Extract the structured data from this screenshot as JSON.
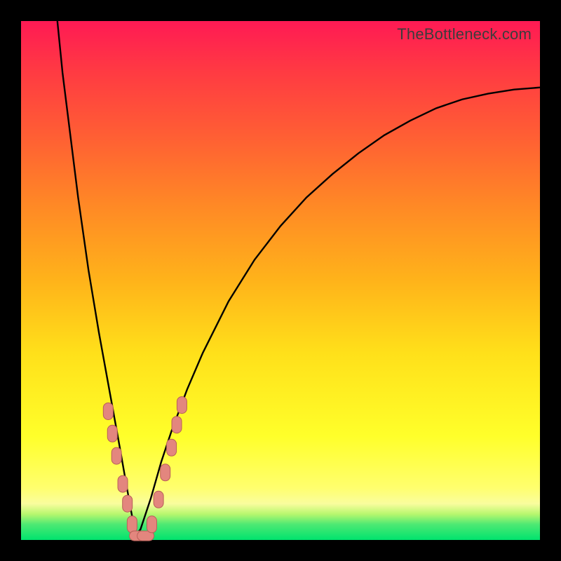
{
  "watermark": "TheBottleneck.com",
  "colors": {
    "curve": "#000000",
    "marker_fill": "#e3867e",
    "marker_stroke": "#b86058",
    "frame": "#000000"
  },
  "chart_data": {
    "type": "line",
    "title": "",
    "xlabel": "",
    "ylabel": "",
    "xlim": [
      0,
      1
    ],
    "ylim": [
      0,
      1
    ],
    "grid": false,
    "legend": false,
    "notes": "V-shaped bottleneck curve with minimum near x≈0.22, y≈0. Left branch reaches y≈1 at x≈0.07; right branch rises toward y≈0.86 at x=1. Pink rounded markers cluster near the trough on both branches.",
    "series": [
      {
        "name": "curve",
        "x": [
          0.07,
          0.08,
          0.095,
          0.11,
          0.13,
          0.15,
          0.17,
          0.19,
          0.205,
          0.215,
          0.22,
          0.23,
          0.25,
          0.27,
          0.29,
          0.32,
          0.35,
          0.4,
          0.45,
          0.5,
          0.55,
          0.6,
          0.65,
          0.7,
          0.75,
          0.8,
          0.85,
          0.9,
          0.95,
          1.0
        ],
        "y": [
          1.0,
          0.9,
          0.78,
          0.66,
          0.52,
          0.4,
          0.29,
          0.18,
          0.095,
          0.04,
          0.01,
          0.02,
          0.08,
          0.15,
          0.21,
          0.29,
          0.36,
          0.46,
          0.54,
          0.605,
          0.66,
          0.705,
          0.745,
          0.78,
          0.808,
          0.832,
          0.849,
          0.86,
          0.868,
          0.872
        ]
      }
    ],
    "markers": {
      "name": "threshold-markers",
      "shape": "rounded-pill",
      "points": [
        {
          "x": 0.168,
          "y": 0.248
        },
        {
          "x": 0.176,
          "y": 0.205
        },
        {
          "x": 0.184,
          "y": 0.162
        },
        {
          "x": 0.196,
          "y": 0.108
        },
        {
          "x": 0.205,
          "y": 0.07
        },
        {
          "x": 0.214,
          "y": 0.03
        },
        {
          "x": 0.225,
          "y": 0.008
        },
        {
          "x": 0.24,
          "y": 0.008
        },
        {
          "x": 0.252,
          "y": 0.03
        },
        {
          "x": 0.265,
          "y": 0.078
        },
        {
          "x": 0.278,
          "y": 0.13
        },
        {
          "x": 0.29,
          "y": 0.178
        },
        {
          "x": 0.3,
          "y": 0.222
        },
        {
          "x": 0.31,
          "y": 0.26
        }
      ]
    }
  }
}
